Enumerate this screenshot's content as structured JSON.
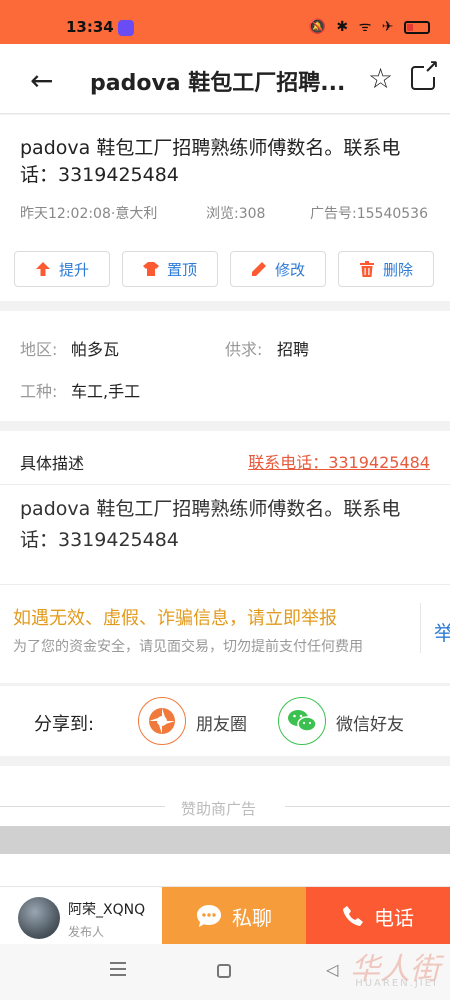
{
  "status_bar": {
    "time": "13:34",
    "icons": "🔕 ✱ ᯤ ✈"
  },
  "header": {
    "title": "padova 鞋包工厂招聘...",
    "back_icon": "arrow-left",
    "star_icon": "star-outline",
    "share_icon": "share-box"
  },
  "post": {
    "title": "padova 鞋包工厂招聘熟练师傅数名。联系电话：3319425484",
    "time_location": "昨天12:02:08·意大利",
    "views": "浏览:308",
    "ad_number": "广告号:15540536"
  },
  "actions": [
    {
      "label": "提升",
      "icon": "arrow-up-icon",
      "color": "#fb5a32"
    },
    {
      "label": "置顶",
      "icon": "shirt-icon",
      "color": "#fb5a32"
    },
    {
      "label": "修改",
      "icon": "pencil-icon",
      "color": "#fb5a32"
    },
    {
      "label": "删除",
      "icon": "trash-icon",
      "color": "#fb5a32"
    }
  ],
  "attributes": {
    "region_label": "地区:",
    "region_value": "帕多瓦",
    "supply_label": "供求:",
    "supply_value": "招聘",
    "job_label": "工种:",
    "job_value": "车工,手工"
  },
  "description": {
    "heading": "具体描述",
    "contact": "联系电话：3319425484",
    "text": "padova 鞋包工厂招聘熟练师傅数名。联系电话：3319425484"
  },
  "warning": {
    "title": "如遇无效、虚假、诈骗信息，请立即举报",
    "subtitle": "为了您的资金安全，请见面交易，切勿提前支付任何费用",
    "report": "举"
  },
  "share": {
    "label": "分享到:",
    "moments": "朋友圈",
    "wechat": "微信好友"
  },
  "sponsor": {
    "label": "赞助商广告"
  },
  "bottom_bar": {
    "user_name": "阿荣_XQNQ",
    "user_role": "发布人",
    "chat": "私聊",
    "call": "电话"
  },
  "watermark": {
    "cn": "华人街",
    "en": "HUAREN.JIEI"
  },
  "colors": {
    "accent": "#fc6a3a",
    "link": "#2e7bd6",
    "warning": "#e29a1c",
    "chat": "#f79c3a",
    "call": "#fb5a32"
  }
}
